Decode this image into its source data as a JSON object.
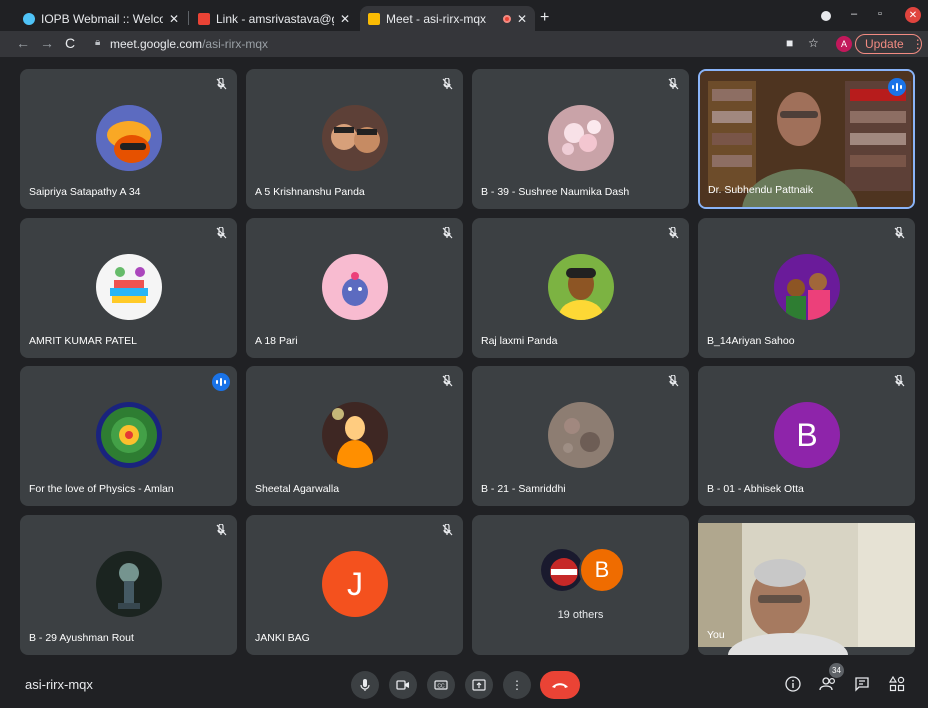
{
  "browser": {
    "tabs": [
      {
        "title": "IOPB Webmail :: Welcome",
        "active": false
      },
      {
        "title": "Link - amsrivastava@gmail",
        "active": false
      },
      {
        "title": "Meet - asi-rirx-mqx",
        "active": true
      }
    ],
    "url_host": "meet.google.com",
    "url_path": "/asi-rirx-mqx",
    "profile_initial": "A",
    "update_label": "Update"
  },
  "tiles": [
    {
      "name": "Saipriya Satapathy A 34",
      "muted": true
    },
    {
      "name": "A 5 Krishnanshu Panda",
      "muted": true
    },
    {
      "name": "B - 39 - Sushree Naumika Dash",
      "muted": true
    },
    {
      "name": "Dr. Subhendu Pattnaik",
      "muted": false,
      "speaking": true
    },
    {
      "name": "AMRIT KUMAR PATEL",
      "muted": true
    },
    {
      "name": "A 18 Pari",
      "muted": true
    },
    {
      "name": "Raj laxmi Panda",
      "muted": true
    },
    {
      "name": "B_14Ariyan Sahoo",
      "muted": true
    },
    {
      "name": "For the love of Physics - Amlan",
      "muted": false,
      "speaking": true
    },
    {
      "name": "Sheetal Agarwalla",
      "muted": true
    },
    {
      "name": "B - 21 - Samriddhi",
      "muted": true
    },
    {
      "name": "B - 01 - Abhisek Otta",
      "muted": true,
      "initial": "B",
      "color": "#8e24aa"
    },
    {
      "name": "B - 29 Ayushman Rout",
      "muted": true
    },
    {
      "name": "JANKI BAG",
      "muted": true,
      "initial": "J",
      "color": "#f4511e"
    },
    {
      "others_label": "19 others",
      "initial": "B",
      "color": "#ef6c00"
    },
    {
      "name": "You"
    }
  ],
  "bottom": {
    "meeting_code": "asi-rirx-mqx",
    "participants_count": "34"
  }
}
